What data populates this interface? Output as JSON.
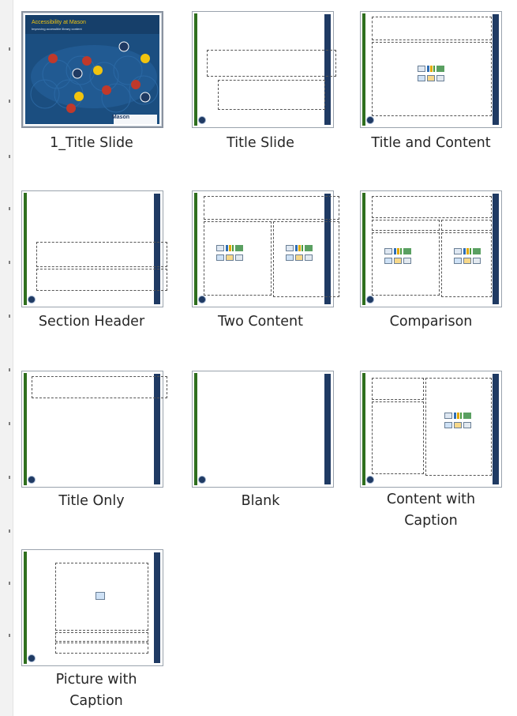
{
  "layouts": [
    {
      "name": "1_Title Slide",
      "selected": true
    },
    {
      "name": "Title Slide"
    },
    {
      "name": "Title and Content"
    },
    {
      "name": "Section Header"
    },
    {
      "name": "Two Content"
    },
    {
      "name": "Comparison"
    },
    {
      "name": "Title Only"
    },
    {
      "name": "Blank"
    },
    {
      "name": "Content with Caption"
    },
    {
      "name": "Picture with Caption"
    }
  ],
  "title_slide_art": {
    "heading": "Accessibility at Mason",
    "subheading": "Improving accessible library content",
    "footer": "Mason"
  },
  "colors": {
    "accent_green": "#2f6f1e",
    "accent_navy": "#1f3a63",
    "slide_blue": "#1b4e80",
    "hex_red": "#c0392b",
    "hex_yellow": "#f1c40f"
  },
  "icons": [
    "table-icon",
    "chart-icon",
    "smartart-icon",
    "picture-icon",
    "online-picture-icon",
    "video-icon"
  ]
}
